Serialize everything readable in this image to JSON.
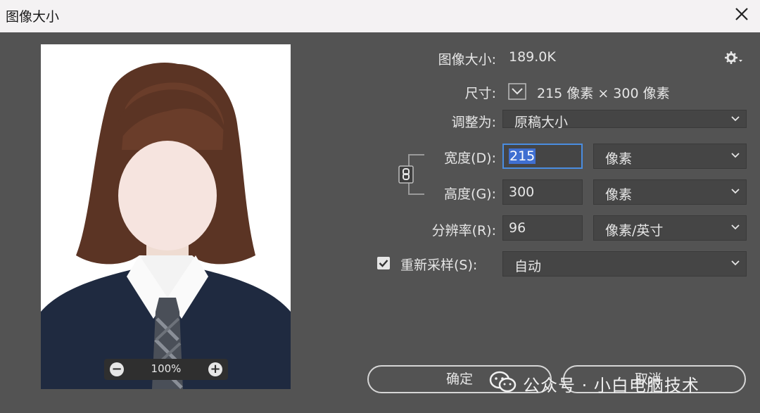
{
  "window": {
    "title": "图像大小",
    "close_icon": "close-icon"
  },
  "preview": {
    "zoom": "100%",
    "zoom_out_symbol": "−",
    "zoom_in_symbol": "+"
  },
  "info": {
    "image_size_label": "图像大小:",
    "image_size_value": "189.0K",
    "dimensions_label": "尺寸:",
    "dimensions_value": "215 像素 × 300 像素",
    "fit_to_label": "调整为:",
    "fit_to_value": "原稿大小"
  },
  "fields": {
    "width_label": "宽度(D):",
    "width_value": "215",
    "width_unit": "像素",
    "height_label": "高度(G):",
    "height_value": "300",
    "height_unit": "像素",
    "resolution_label": "分辨率(R):",
    "resolution_value": "96",
    "resolution_unit": "像素/英寸",
    "resample_label": "重新采样(S):",
    "resample_checked": true,
    "resample_value": "自动"
  },
  "buttons": {
    "ok": "确定",
    "cancel": "取消"
  },
  "watermark": "公众号 · 小白电脑技术",
  "colors": {
    "dialog_bg": "#535353",
    "titlebar_bg": "#f4f2f3",
    "field_bg": "#454545",
    "focus": "#4a8de0",
    "selection": "#3f6fd1"
  }
}
